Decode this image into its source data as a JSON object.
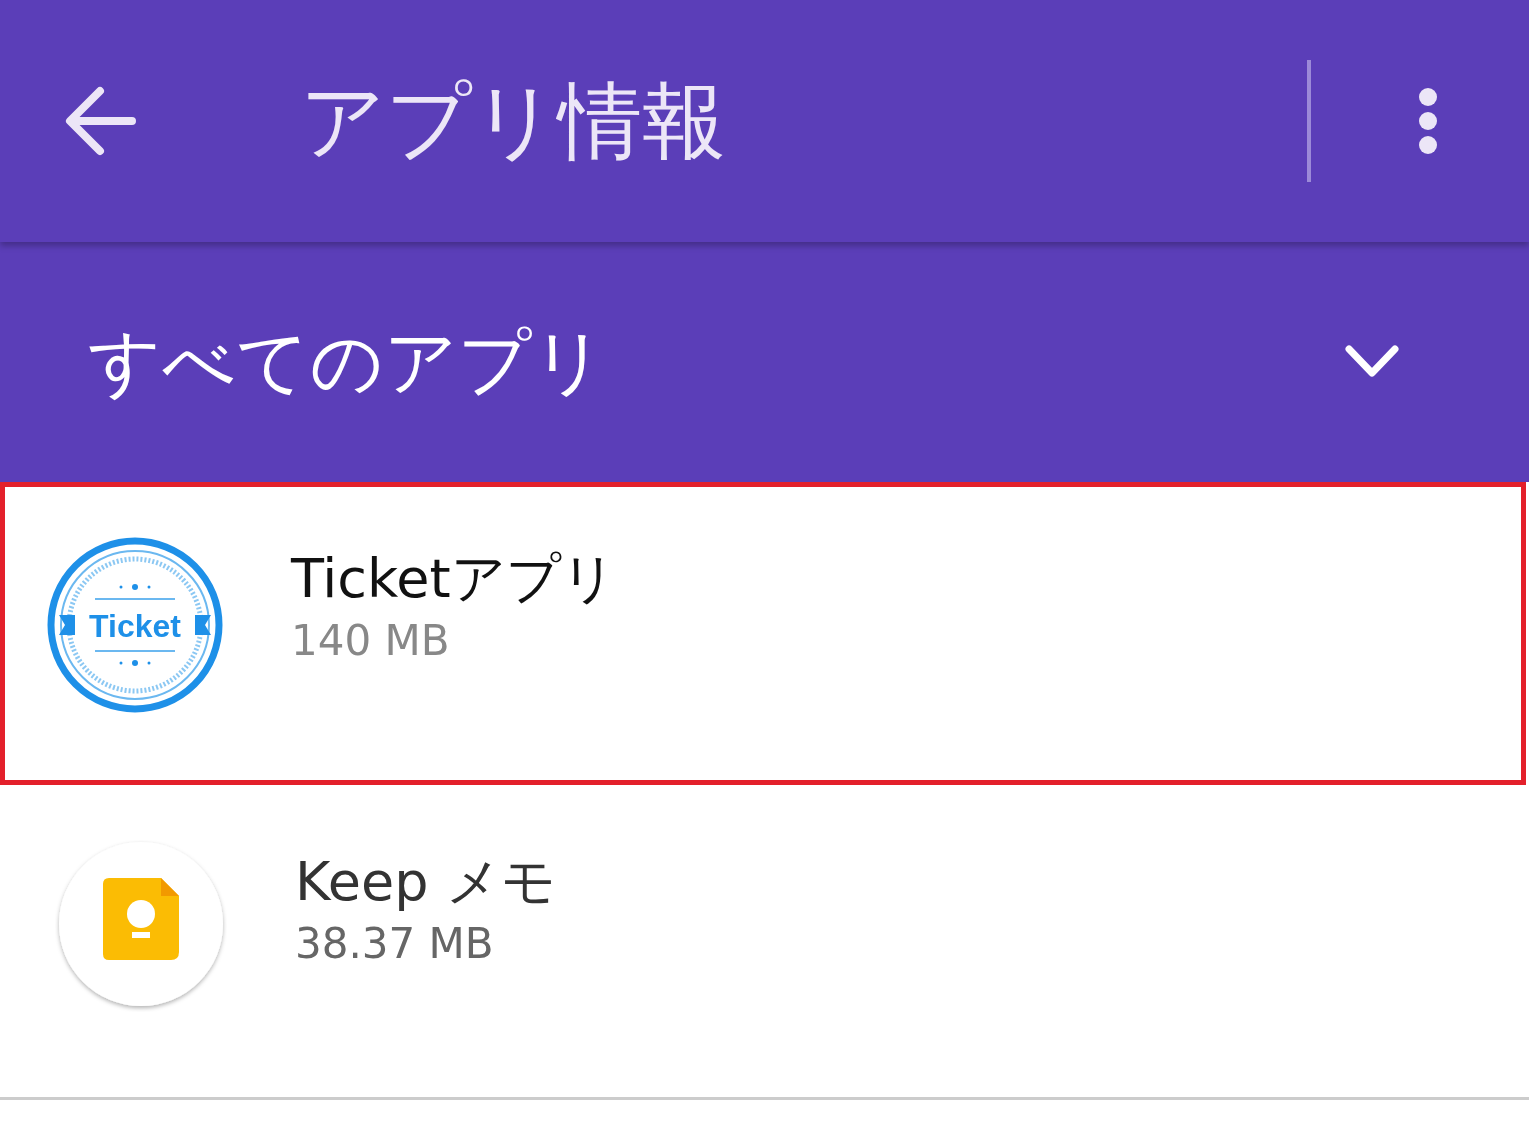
{
  "app_bar": {
    "title": "アプリ情報"
  },
  "filter": {
    "label": "すべてのアプリ"
  },
  "apps": [
    {
      "kind": "ticket",
      "icon_text": "Ticket",
      "name": "Ticketアプリ",
      "size": "140 MB",
      "highlighted": true
    },
    {
      "kind": "keep",
      "name": "Keep メモ",
      "size": "38.37 MB",
      "highlighted": false
    }
  ]
}
